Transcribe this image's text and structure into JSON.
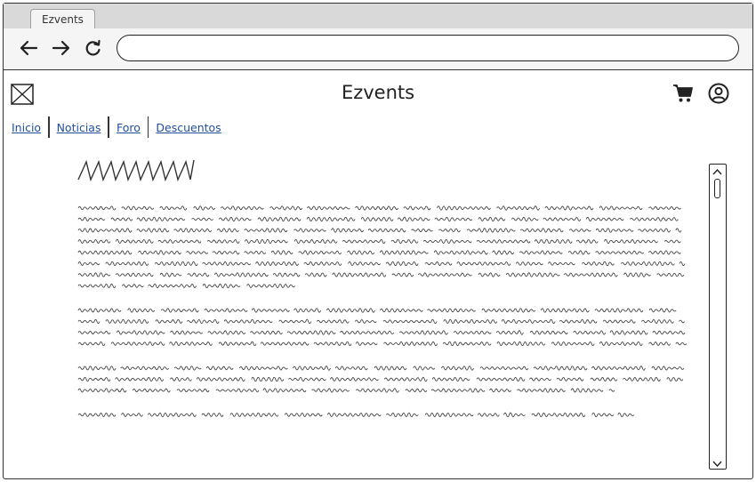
{
  "browser": {
    "tab_title": "Ezvents",
    "back_icon": "back-arrow-icon",
    "forward_icon": "forward-arrow-icon",
    "reload_icon": "reload-icon",
    "url_value": ""
  },
  "header": {
    "logo_icon": "image-placeholder-icon",
    "title": "Ezvents",
    "cart_icon": "cart-icon",
    "user_icon": "user-account-icon"
  },
  "nav": {
    "items": [
      {
        "label": "Inicio"
      },
      {
        "label": "Noticias"
      },
      {
        "label": "Foro"
      },
      {
        "label": "Descuentos"
      }
    ]
  },
  "article": {
    "heading_placeholder": "squiggle-heading",
    "paragraph_line_counts": [
      8,
      4,
      3,
      1
    ]
  }
}
